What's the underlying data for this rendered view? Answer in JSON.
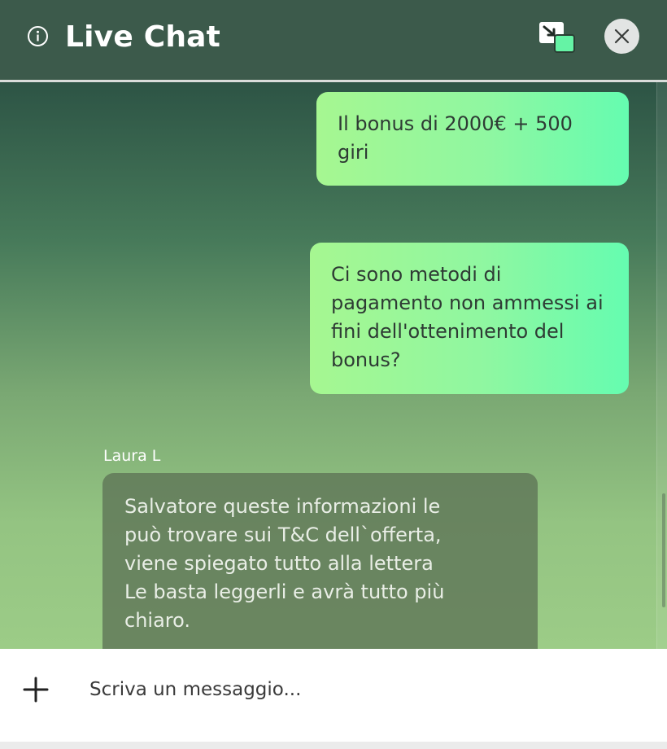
{
  "header": {
    "title": "Live Chat",
    "info_icon": "info-icon",
    "popout_icon": "minimize-window-icon",
    "close_icon": "close-icon"
  },
  "colors": {
    "header_bg": "#3c5a4b",
    "outgoing_bubble": "#8ff7a1",
    "incoming_bubble": "#5f7658",
    "accent_green": "#65fcb0"
  },
  "messages": [
    {
      "direction": "outgoing",
      "text": "Il bonus di 2000€ + 500\ngiri"
    },
    {
      "direction": "outgoing",
      "text": "Ci sono metodi di\npagamento non ammessi ai\nfini dell'ottenimento del\nbonus?"
    },
    {
      "direction": "incoming",
      "sender": "Laura L",
      "text": "Salvatore queste informazioni le\npuò trovare sui T&C dell`offerta,\nviene spiegato tutto alla lettera\nLe basta leggerli e avrà tutto più\nchiaro."
    }
  ],
  "composer": {
    "placeholder": "Scriva un messaggio...",
    "add_icon": "plus-icon"
  }
}
